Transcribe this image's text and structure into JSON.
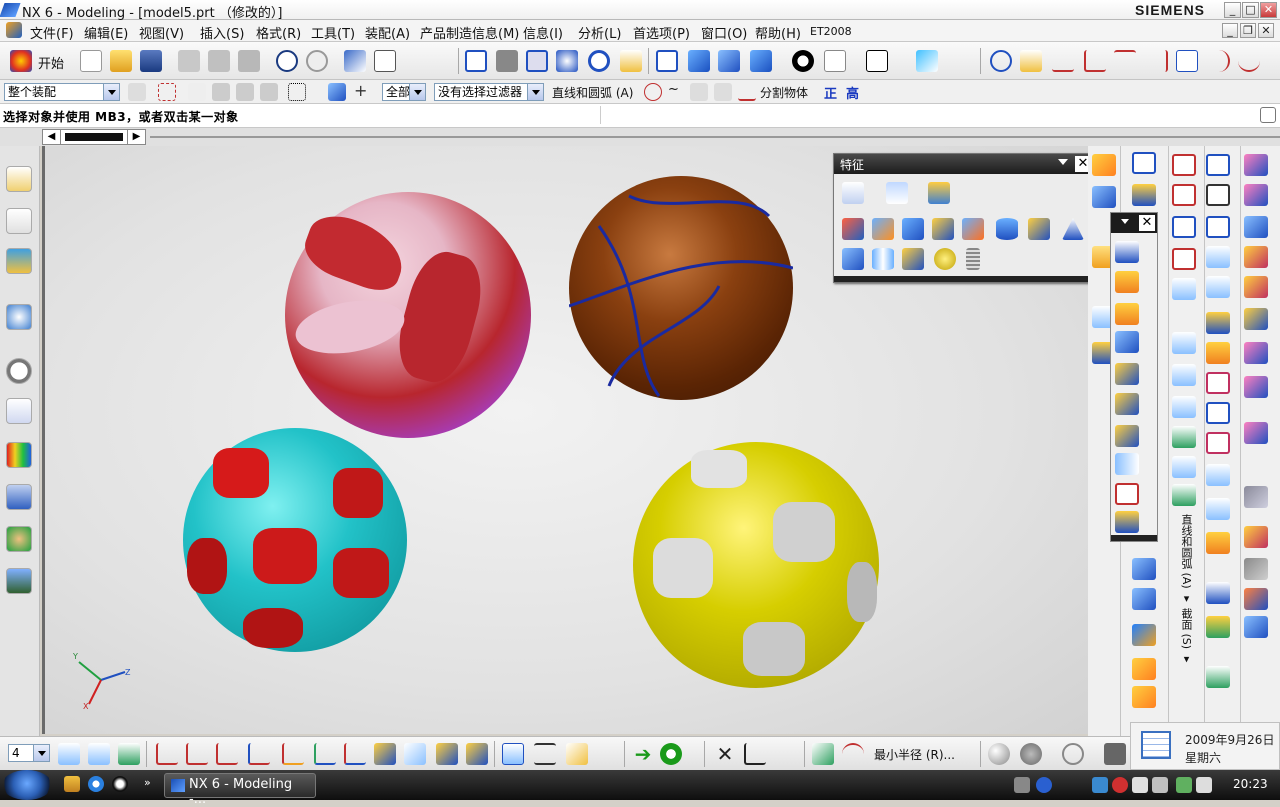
{
  "window": {
    "title": "NX 6 - Modeling - [model5.prt （修改的）]",
    "brand": "SIEMENS",
    "controls": [
      "_",
      "□",
      "✕"
    ],
    "doc_controls": [
      "_",
      "❐",
      "✕"
    ]
  },
  "menu": [
    "文件(F)",
    "编辑(E)",
    "视图(V)",
    "插入(S)",
    "格式(R)",
    "工具(T)",
    "装配(A)",
    "产品制造信息(M)",
    "信息(I)",
    "分析(L)",
    "首选项(P)",
    "窗口(O)",
    "帮助(H)",
    "ET2008"
  ],
  "toolbar": {
    "start_label": "开始"
  },
  "selection_bar": {
    "assembly_filter": "整个装配",
    "scope": "全部",
    "filter": "没有选择过滤器",
    "curve_rule": "直线和圆弧 (A)",
    "split": "分割物体",
    "btn_zheng": "正",
    "btn_gao": "高"
  },
  "status": {
    "prompt": "选择对象并使用 MB3，或者双击某一对象"
  },
  "feature_toolbar": {
    "title": "特征",
    "close": "✕"
  },
  "mini_toolbar": {
    "close": "✕"
  },
  "vertical_labels": {
    "curve_rule": "直线和圆弧 (A) ▾",
    "section": "截面 (S) ▾"
  },
  "bottom": {
    "layer": "4",
    "min_radius": "最小半径 (R)..."
  },
  "date": {
    "date": "2009年9月26日",
    "weekday": "星期六"
  },
  "taskbar": {
    "app_button": "NX 6 - Modeling -...",
    "time": "20:23"
  },
  "triad": {
    "x": "X",
    "y": "Y",
    "z": "Z"
  },
  "colors": {
    "volleyball_purple": "#a83aae",
    "volleyball_red": "#b8262e",
    "volleyball_pink": "#e6b6c6",
    "basketball": "#6a3006",
    "basketball_lines": "#1a2aa0",
    "soccer_red": "#cc1a1a",
    "soccer_cyan": "#22c2c8",
    "soccer_yellow": "#d6ce00",
    "soccer_white": "#d6d6d6"
  }
}
